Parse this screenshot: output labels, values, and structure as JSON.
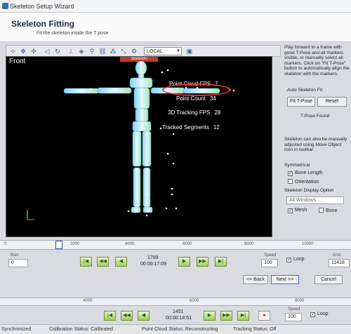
{
  "window": {
    "title": "Skeleton Setup Wizard"
  },
  "header": {
    "title": "Skeleton Fitting",
    "subtitle": "Fit the skeleton inside the T pose"
  },
  "toolbar": {
    "coordinate_space": "LOCAL"
  },
  "viewport": {
    "view_label": "Front",
    "skeleton_tag": "Skeleton",
    "stats": [
      {
        "label": "Point Cloud FPS",
        "value": "7"
      },
      {
        "label": "Point Count",
        "value": "34"
      },
      {
        "label": "3D Tracking FPS",
        "value": "28"
      },
      {
        "label": "Tracked Segments",
        "value": "12"
      }
    ]
  },
  "side_panel": {
    "instructions": "Play forward to a frame with good T-Pose and all markers visible, or manually select all markers. Click on \"Fit T-Pose\" button to automatically align the skeleton with the markers.",
    "auto_fit_label": "Auto Skeleton Fit",
    "fit_button": "Fit T-Pose",
    "reset_button": "Reset",
    "fit_status": "T-Pose Found",
    "manual_note": "Skeleton can also be manually adjusted using Move Object icon in toolbar.",
    "symmetrical_label": "Symmetrical",
    "bone_length_label": "Bone Length",
    "orientation_label": "Orientation",
    "display_option_label": "Skeleton Display Option",
    "display_dropdown": "All Windows",
    "mesh_label": "Mesh",
    "bone_label": "Bone"
  },
  "timeline_top": {
    "ticks": [
      "0",
      "2000",
      "4000",
      "6000",
      "8000",
      "10000"
    ],
    "start_label": "Start",
    "start_value": "0",
    "current_frame": "1789",
    "current_time": "00:00:17:09",
    "speed_label": "Speed",
    "speed_value": "100",
    "loop_label": "Loop",
    "end_label": "End",
    "end_value": "11418",
    "playhead_fraction": 0.157
  },
  "nav": {
    "back": "<< Back",
    "next": "Next >>",
    "cancel": "Cancel"
  },
  "timeline_bottom": {
    "ticks": [
      "4000",
      "6000",
      "8000"
    ],
    "current_frame": "1451",
    "current_time": "00:00:14:51",
    "speed_label": "Speed",
    "speed_value": "100",
    "loop_label": "Loop"
  },
  "status_bar": {
    "left": "Synchronized",
    "calibration": "Calibration Status: Calibrated",
    "point_cloud": "Point Cloud Status: Reconstructing",
    "tracking": "Tracking Status: Off"
  },
  "colors": {
    "viewport_bg": "#000000",
    "highlight_circle": "#e8302a",
    "play_green": "#9fcf5c",
    "skeleton_tag": "#c0392b"
  }
}
